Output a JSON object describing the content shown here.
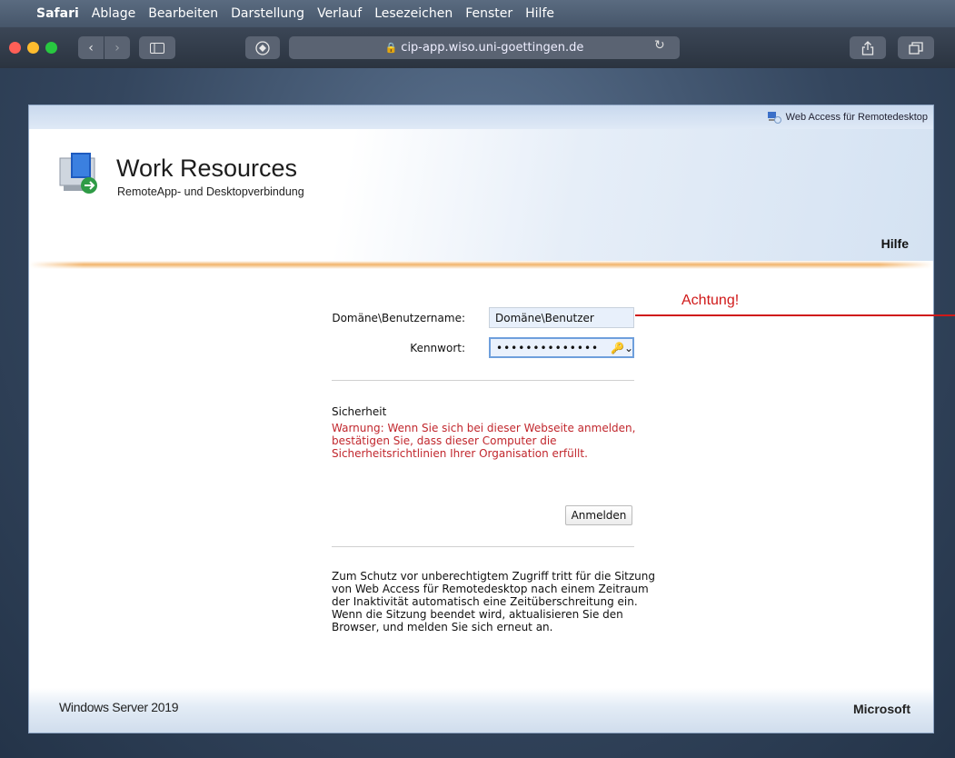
{
  "menubar": {
    "app": "Safari",
    "items": [
      "Ablage",
      "Bearbeiten",
      "Darstellung",
      "Verlauf",
      "Lesezeichen",
      "Fenster",
      "Hilfe"
    ]
  },
  "browser": {
    "url": "cip-app.wiso.uni-goettingen.de"
  },
  "rdweb": {
    "topbar_link": "Web Access für Remotedesktop",
    "title": "Work Resources",
    "subtitle": "RemoteApp- und Desktopverbindung",
    "help_link": "Hilfe",
    "form": {
      "username_label": "Domäne\\Benutzername:",
      "username_value": "Domäne\\Benutzer",
      "password_label": "Kennwort:",
      "password_value": "••••••••••••••",
      "security_heading": "Sicherheit",
      "warning": "Warnung: Wenn Sie sich bei dieser Webseite anmelden, bestätigen Sie, dass dieser Computer die Sicherheitsrichtlinien Ihrer Organisation erfüllt.",
      "login_button": "Anmelden",
      "info": "Zum Schutz vor unberechtigtem Zugriff tritt für die Sitzung von Web Access für Remotedesktop nach einem Zeitraum der Inaktivität automatisch eine Zeitüberschreitung ein. Wenn die Sitzung beendet wird, aktualisieren Sie den Browser, und melden Sie sich erneut an."
    },
    "footer_left": "Windows Server 2019",
    "footer_right": "Microsoft"
  },
  "annotation": {
    "text": "Achtung!",
    "color": "#d01818"
  }
}
